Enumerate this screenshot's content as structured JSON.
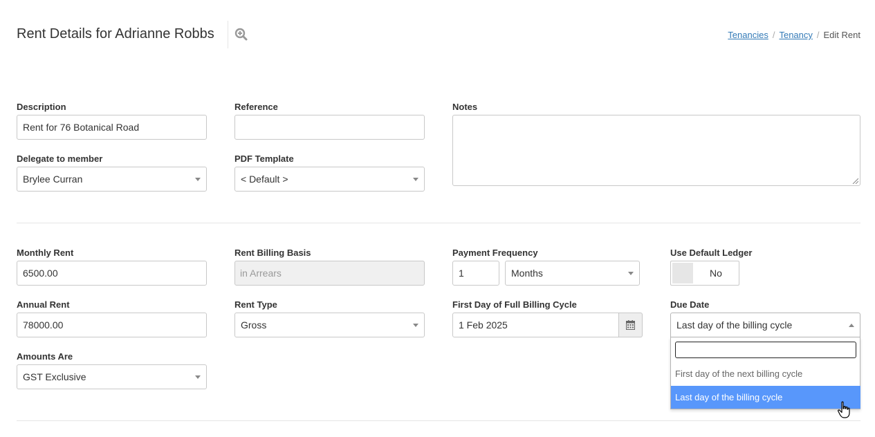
{
  "header": {
    "title": "Rent Details for Adrianne Robbs",
    "zoom_icon": "zoom-in-icon",
    "breadcrumb": [
      "Tenancies",
      "Tenancy",
      "Edit Rent"
    ]
  },
  "details": {
    "description": {
      "label": "Description",
      "value": "Rent for 76 Botanical Road"
    },
    "reference": {
      "label": "Reference",
      "value": ""
    },
    "notes": {
      "label": "Notes",
      "value": ""
    },
    "delegate": {
      "label": "Delegate to member",
      "value": "Brylee Curran"
    },
    "pdf_template": {
      "label": "PDF Template",
      "value": "< Default >"
    }
  },
  "rent": {
    "monthly_rent": {
      "label": "Monthly Rent",
      "value": "6500.00"
    },
    "billing_basis": {
      "label": "Rent Billing Basis",
      "value": "in Arrears"
    },
    "payment_frequency": {
      "label": "Payment Frequency",
      "count": "1",
      "unit": "Months"
    },
    "default_ledger": {
      "label": "Use Default Ledger",
      "value": "No"
    },
    "annual_rent": {
      "label": "Annual Rent",
      "value": "78000.00"
    },
    "rent_type": {
      "label": "Rent Type",
      "value": "Gross"
    },
    "first_day": {
      "label": "First Day of Full Billing Cycle",
      "value": "1 Feb 2025",
      "icon": "calendar-icon"
    },
    "due_date": {
      "label": "Due Date",
      "value": "Last day of the billing cycle",
      "search_value": "",
      "options": [
        "First day of the next billing cycle",
        "Last day of the billing cycle"
      ],
      "selected_index": 1
    },
    "amounts_are": {
      "label": "Amounts Are",
      "value": "GST Exclusive"
    }
  },
  "colors": {
    "link": "#337ab7",
    "selected_option": "#5897fb",
    "border": "#c8c8c8"
  }
}
